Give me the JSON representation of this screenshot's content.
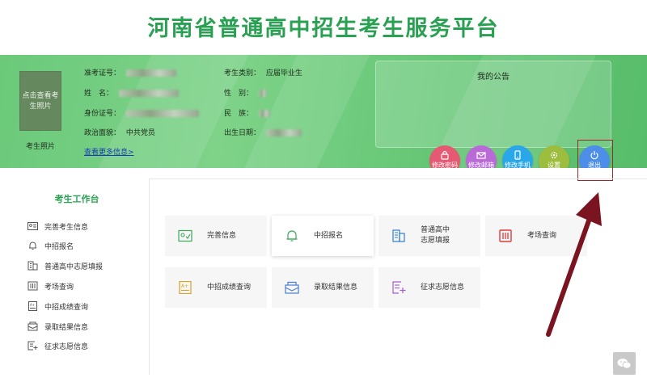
{
  "header": {
    "title": "河南省普通高中招生考生服务平台"
  },
  "profile": {
    "photo_placeholder": "点击查看考生照片",
    "photo_label": "考生照片",
    "fields_left": [
      {
        "label": "准考证号："
      },
      {
        "label": "姓　名："
      },
      {
        "label": "身份证号："
      },
      {
        "label": "政治面貌：",
        "value": "中共党员"
      }
    ],
    "fields_right": [
      {
        "label": "考生类别：",
        "value": "应届毕业生"
      },
      {
        "label": "性　别："
      },
      {
        "label": "民　族："
      },
      {
        "label": "出生日期："
      }
    ],
    "more_link": "查看更多信息>"
  },
  "notice": {
    "title": "我的公告"
  },
  "actions": [
    {
      "label": "修改密码",
      "color": "#e55a72",
      "icon": "lock-icon"
    },
    {
      "label": "修改邮箱",
      "color": "#b96ad6",
      "icon": "mail-icon"
    },
    {
      "label": "修改手机",
      "color": "#2aa7e8",
      "icon": "phone-icon"
    },
    {
      "label": "设置",
      "color": "#9dbd3e",
      "icon": "gear-icon"
    },
    {
      "label": "退出",
      "color": "#4d8fe8",
      "icon": "power-icon"
    }
  ],
  "sidebar": {
    "title": "考生工作台",
    "items": [
      {
        "label": "完善考生信息"
      },
      {
        "label": "中招报名"
      },
      {
        "label": "普通高中志愿填报"
      },
      {
        "label": "考场查询"
      },
      {
        "label": "中招成绩查询"
      },
      {
        "label": "录取结果信息"
      },
      {
        "label": "征求志愿信息"
      }
    ]
  },
  "tiles": [
    {
      "label": "完善信息",
      "icon_color": "#3aa85a"
    },
    {
      "label": "中招报名",
      "icon_color": "#3aa85a"
    },
    {
      "label_line1": "普通高中",
      "label_line2": "志愿填报",
      "icon_color": "#2f7fd3"
    },
    {
      "label": "考场查询",
      "icon_color": "#e23b3b"
    },
    {
      "label": "中招成绩查询",
      "icon_color": "#d9a32a"
    },
    {
      "label": "录取结果信息",
      "icon_color": "#4a7fd6"
    },
    {
      "label": "征求志愿信息",
      "icon_color": "#a35fc9"
    }
  ],
  "colors": {
    "brand_green": "#2aa152",
    "arrow": "#7a1420"
  }
}
